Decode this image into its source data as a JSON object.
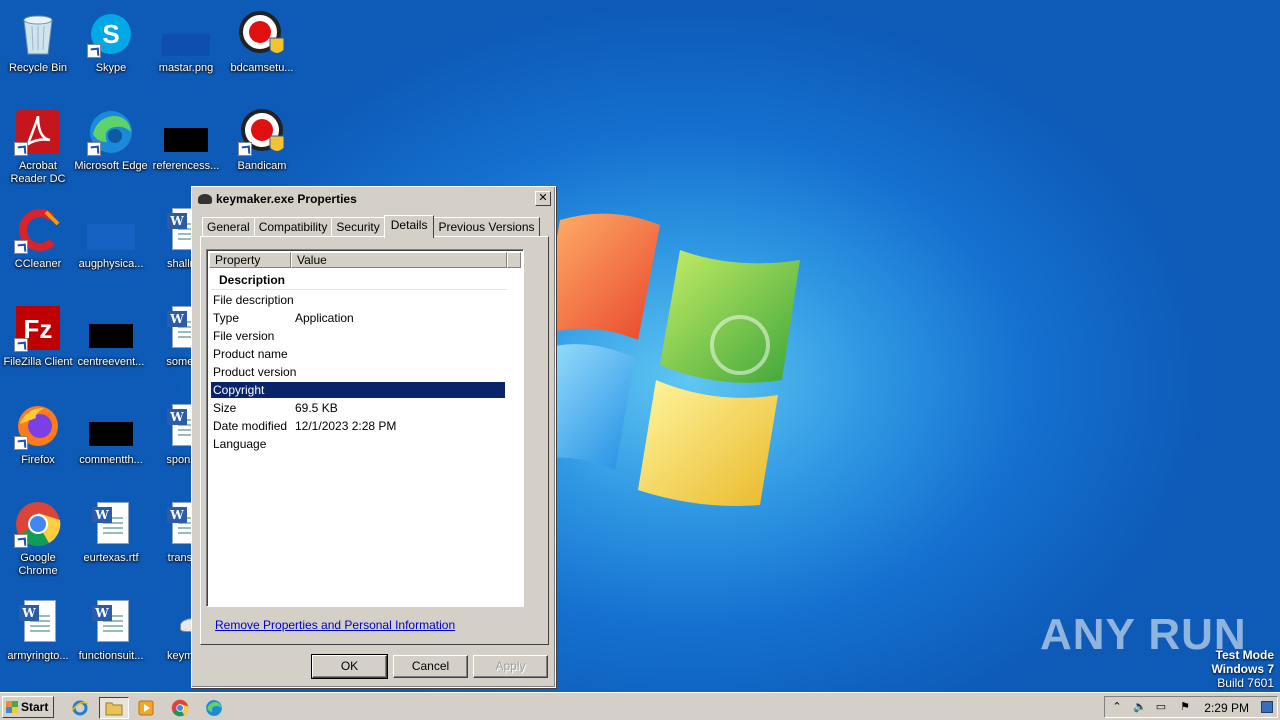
{
  "desktop": {
    "icons": [
      {
        "label": "Recycle Bin"
      },
      {
        "label": "Skype"
      },
      {
        "label": "mastar.png"
      },
      {
        "label": "bdcamsetu..."
      },
      {
        "label": "Acrobat Reader DC"
      },
      {
        "label": "Microsoft Edge"
      },
      {
        "label": "referencess..."
      },
      {
        "label": "Bandicam"
      },
      {
        "label": "CCleaner"
      },
      {
        "label": "augphysica..."
      },
      {
        "label": "shallrec"
      },
      {
        "label": "FileZilla Client"
      },
      {
        "label": "centreevent..."
      },
      {
        "label": "someon"
      },
      {
        "label": "Firefox"
      },
      {
        "label": "commentth..."
      },
      {
        "label": "sponsor"
      },
      {
        "label": "Google Chrome"
      },
      {
        "label": "eurtexas.rtf"
      },
      {
        "label": "transpo"
      },
      {
        "label": "armyringto..."
      },
      {
        "label": "functionsuit..."
      },
      {
        "label": "keymak"
      }
    ]
  },
  "dialog": {
    "title": "keymaker.exe Properties",
    "close_glyph": "✕",
    "tabs": [
      "General",
      "Compatibility",
      "Security",
      "Details",
      "Previous Versions"
    ],
    "active_tab": "Details",
    "columns": {
      "property": "Property",
      "value": "Value"
    },
    "section": "Description",
    "rows": [
      {
        "key": "File description",
        "value": ""
      },
      {
        "key": "Type",
        "value": "Application"
      },
      {
        "key": "File version",
        "value": ""
      },
      {
        "key": "Product name",
        "value": ""
      },
      {
        "key": "Product version",
        "value": ""
      },
      {
        "key": "Copyright",
        "value": ""
      },
      {
        "key": "Size",
        "value": "69.5 KB"
      },
      {
        "key": "Date modified",
        "value": "12/1/2023 2:28 PM"
      },
      {
        "key": "Language",
        "value": ""
      }
    ],
    "selected_row": "Copyright",
    "remove_link": "Remove Properties and Personal Information",
    "buttons": {
      "ok": "OK",
      "cancel": "Cancel",
      "apply": "Apply"
    }
  },
  "watermark": {
    "text": "ANY  RUN"
  },
  "os_info": {
    "line1": "Test Mode",
    "line2": "Windows 7",
    "line3": "Build 7601"
  },
  "taskbar": {
    "start_label": "Start",
    "pinned": [
      "internet-explorer-icon",
      "explorer-folder-icon",
      "media-player-icon",
      "chrome-icon",
      "edge-icon"
    ],
    "clock": "2:29 PM"
  },
  "colors": {
    "selection": "#0a246a",
    "dialog_face": "#d4d0c8",
    "link": "#0000cc"
  }
}
